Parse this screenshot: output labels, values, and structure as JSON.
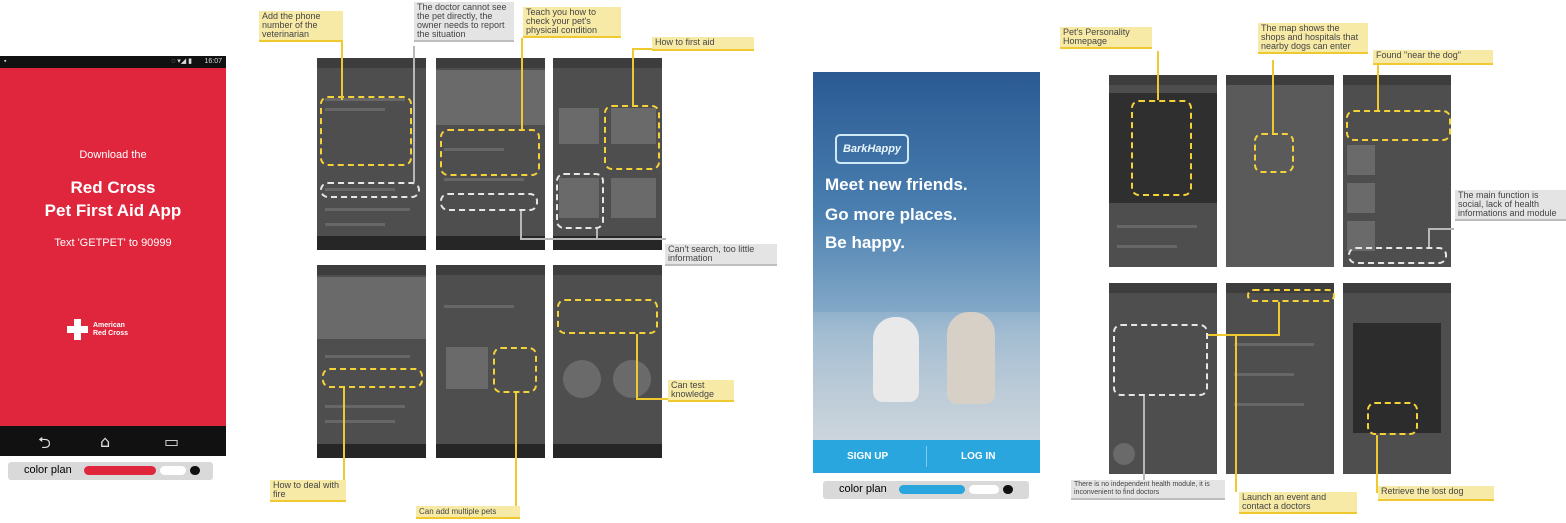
{
  "redcross_phone": {
    "status_time": "16:07",
    "status_icons": "◌ ▾◢ ▮",
    "download_line": "Download the",
    "title_line1": "Red Cross",
    "title_line2": "Pet First Aid App",
    "text_line": "Text 'GETPET' to 90999",
    "logo_line1": "American",
    "logo_line2": "Red Cross",
    "nav_back": "⮌",
    "nav_home": "⌂",
    "nav_recent": "▭",
    "color_plan_label": "color plan",
    "colors": {
      "primary": "#e0263d",
      "secondary": "#ffffff",
      "dark": "#111111"
    }
  },
  "redcross_notes": {
    "vet_phone": "Add the phone number of the veterinarian",
    "doctor_cannot_see": "The doctor cannot see the pet directly, the owner needs to report the situation",
    "teach_check": "Teach you how to check your pet's physical condition",
    "first_aid": "How to first aid",
    "cant_search": "Can't search, too little information",
    "fire": "How to deal with fire",
    "multiple_pets": "Can add multiple pets",
    "test_knowledge": "Can test knowledge"
  },
  "barkhappy_phone": {
    "logo": "BarkHappy",
    "tagline1": "Meet new friends.",
    "tagline2": "Go more places.",
    "tagline3": "Be happy.",
    "sign_up": "SIGN UP",
    "log_in": "LOG IN",
    "color_plan_label": "color plan",
    "colors": {
      "primary": "#2aa6df",
      "secondary": "#ffffff",
      "dark": "#111111"
    }
  },
  "barkhappy_notes": {
    "personality": "Pet's Personality Homepage",
    "map_shows": "The map shows the shops and hospitals that nearby dogs can enter",
    "found_near": "Found \"near the dog\"",
    "main_function": "The main function is social, lack of health informations and module",
    "no_health_module": "There is no independent health module, it is inconvenient to find doctors",
    "launch_event": "Launch an event and contact a doctors",
    "lost_dog": "Retrieve the lost dog"
  }
}
